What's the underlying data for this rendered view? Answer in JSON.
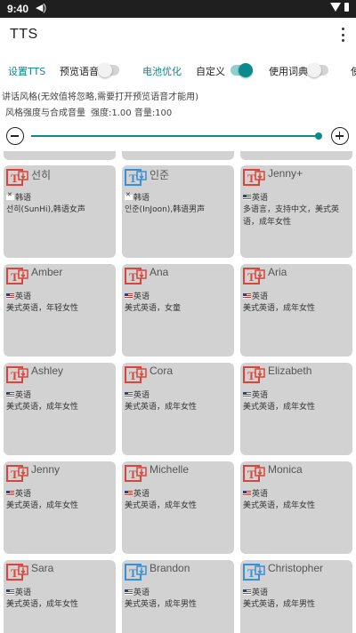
{
  "status": {
    "time": "9:40"
  },
  "app": {
    "title": "TTS"
  },
  "tabs": [
    {
      "label": "设置TTS",
      "active": true
    },
    {
      "label": "预览语音",
      "switch": "off"
    },
    {
      "label": "电池优化",
      "active": true
    },
    {
      "label": "自定义",
      "switch": "on"
    },
    {
      "label": "使用词典",
      "switch": "off"
    },
    {
      "label": "使"
    }
  ],
  "settings": {
    "style_note": "讲话风格(无效值将忽略,需要打开预览语音才能用)",
    "strength_label": "风格强度与合成音量",
    "strength_values": "强度:1.00 音量:100"
  },
  "colors": {
    "accent": "#0a8a8a",
    "icon_red": "#d9453b",
    "icon_blue": "#3b8fd6",
    "card_bg": "#d2d2d2"
  },
  "voices": [
    {
      "name": "선히",
      "lang": "韩语",
      "flag": "kr",
      "desc": "선히(SunHi),韩语女声",
      "icon": "red"
    },
    {
      "name": "인준",
      "lang": "韩语",
      "flag": "kr",
      "desc": "인준(InJoon),韩语男声",
      "icon": "blue"
    },
    {
      "name": "Jenny+",
      "lang": "英语",
      "flag": "us",
      "desc": "多语言，支持中文，美式英语，成年女性",
      "icon": "red"
    },
    {
      "name": "Amber",
      "lang": "英语",
      "flag": "us",
      "desc": "美式英语，年轻女性",
      "icon": "red"
    },
    {
      "name": "Ana",
      "lang": "英语",
      "flag": "us",
      "desc": "美式英语，女童",
      "icon": "red"
    },
    {
      "name": "Aria",
      "lang": "英语",
      "flag": "us",
      "desc": "美式英语，成年女性",
      "icon": "red"
    },
    {
      "name": "Ashley",
      "lang": "英语",
      "flag": "us",
      "desc": "美式英语，成年女性",
      "icon": "red"
    },
    {
      "name": "Cora",
      "lang": "英语",
      "flag": "us",
      "desc": "美式英语，成年女性",
      "icon": "red"
    },
    {
      "name": "Elizabeth",
      "lang": "英语",
      "flag": "us",
      "desc": "美式英语，成年女性",
      "icon": "red"
    },
    {
      "name": "Jenny",
      "lang": "英语",
      "flag": "us",
      "desc": "美式英语，成年女性",
      "icon": "red"
    },
    {
      "name": "Michelle",
      "lang": "英语",
      "flag": "us",
      "desc": "美式英语，成年女性",
      "icon": "red"
    },
    {
      "name": "Monica",
      "lang": "英语",
      "flag": "us",
      "desc": "美式英语，成年女性",
      "icon": "red"
    },
    {
      "name": "Sara",
      "lang": "英语",
      "flag": "us",
      "desc": "美式英语，成年女性",
      "icon": "red"
    },
    {
      "name": "Brandon",
      "lang": "英语",
      "flag": "us",
      "desc": "美式英语，成年男性",
      "icon": "blue"
    },
    {
      "name": "Christopher",
      "lang": "英语",
      "flag": "us",
      "desc": "美式英语，成年男性",
      "icon": "blue"
    }
  ]
}
